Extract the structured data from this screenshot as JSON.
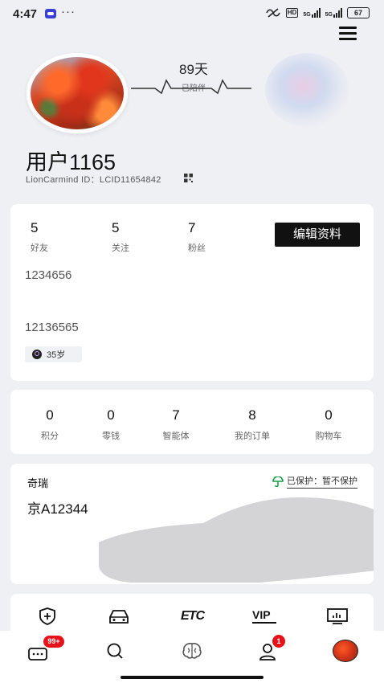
{
  "status_bar": {
    "time": "4:47",
    "dots": "···",
    "hd_label": "HD",
    "net_label_1": "5G",
    "net_label_2": "5G",
    "battery": "67"
  },
  "profile": {
    "days_value": "89天",
    "days_label": "已陪伴",
    "username": "用户1165",
    "user_id": "LionCarmind ID：LCID11654842"
  },
  "stats": [
    {
      "value": "5",
      "label": "好友"
    },
    {
      "value": "5",
      "label": "关注"
    },
    {
      "value": "7",
      "label": "粉丝"
    }
  ],
  "edit_button": "编辑资料",
  "info": {
    "line1": "1234656",
    "line2": "12136565",
    "age": "35岁"
  },
  "metrics": [
    {
      "value": "0",
      "label": "积分"
    },
    {
      "value": "0",
      "label": "零钱"
    },
    {
      "value": "7",
      "label": "智能体"
    },
    {
      "value": "8",
      "label": "我的订单"
    },
    {
      "value": "0",
      "label": "购物车"
    }
  ],
  "vehicle": {
    "brand": "奇瑞",
    "plate": "京A12344",
    "protection_status": "已保护：",
    "protection_action": "暂不保护"
  },
  "services": [
    {
      "icon": "shield-plus-icon"
    },
    {
      "icon": "car-service-icon"
    },
    {
      "icon": "etc-icon",
      "label": "ETC"
    },
    {
      "icon": "vip-icon",
      "label": "VIP"
    },
    {
      "icon": "monitor-chart-icon"
    }
  ],
  "tabbar": {
    "messages_badge": "99+",
    "profile_badge": "1"
  },
  "colors": {
    "background": "#eef0f4",
    "card": "#ffffff",
    "edit_button": "#111111",
    "badge": "#e5121b",
    "protect_icon": "#1a9e45"
  }
}
